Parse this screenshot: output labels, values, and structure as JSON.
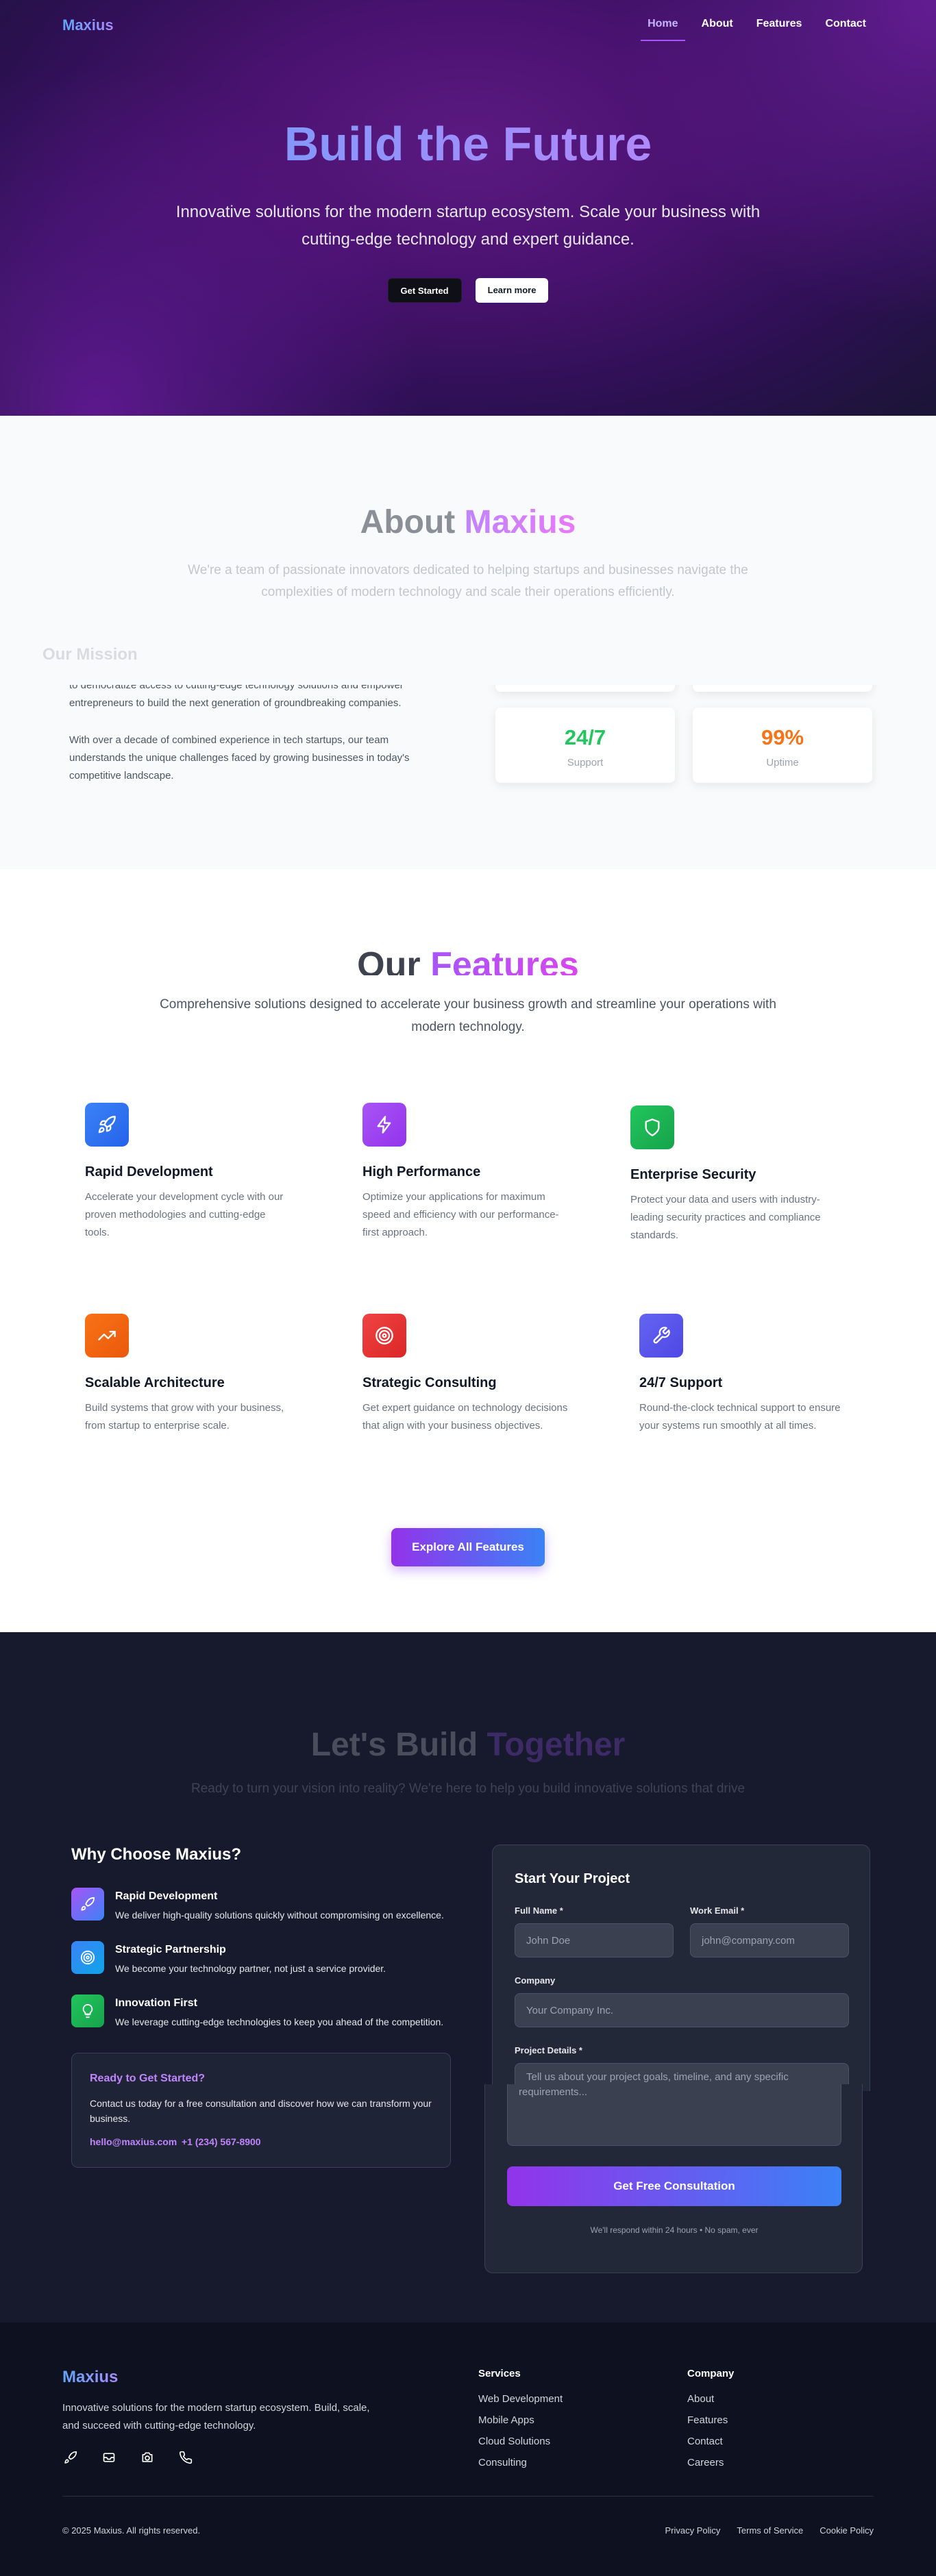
{
  "nav": {
    "logo": "Maxius",
    "links": [
      "Home",
      "About",
      "Features",
      "Contact"
    ]
  },
  "hero": {
    "title": "Build the Future",
    "subtitle": "Innovative solutions for the modern startup ecosystem. Scale your business with cutting-edge technology and expert guidance.",
    "primary_button": "Get Started",
    "secondary_button": "Learn more"
  },
  "about": {
    "title_plain": "About",
    "title_accent": "Maxius",
    "subtitle": "We're a team of passionate innovators dedicated to helping startups and businesses navigate the complexities of modern technology and scale their operations efficiently.",
    "mission_title": "Our Mission",
    "mission_p1": "to democratize access to cutting-edge technology solutions and empower entrepreneurs to build the next generation of groundbreaking companies.",
    "mission_p2": "With over a decade of combined experience in tech startups, our team understands the unique challenges faced by growing businesses in today's competitive landscape.",
    "stats": [
      {
        "value": "24/7",
        "label": "Support",
        "color": "#22c55e"
      },
      {
        "value": "99%",
        "label": "Uptime",
        "color": "#f97316"
      }
    ]
  },
  "features": {
    "title_plain": "Our",
    "title_accent": "Features",
    "subtitle": "Comprehensive solutions designed to accelerate your business growth and streamline your operations with modern technology.",
    "items": [
      {
        "name": "Rapid Development",
        "desc": "Accelerate your development cycle with our proven methodologies and cutting-edge tools.",
        "icon": "rocket-icon",
        "color": "#3b82f6"
      },
      {
        "name": "High Performance",
        "desc": "Optimize your applications for maximum speed and efficiency with our performance-first approach.",
        "icon": "lightning-icon",
        "color": "#a855f7"
      },
      {
        "name": "Enterprise Security",
        "desc": "Protect your data and users with industry-leading security practices and compliance standards.",
        "icon": "shield-icon",
        "color": "#16a34a"
      },
      {
        "name": "Scalable Architecture",
        "desc": "Build systems that grow with your business, from startup to enterprise scale.",
        "icon": "trending-up-icon",
        "color": "#f97316"
      },
      {
        "name": "Strategic Consulting",
        "desc": "Get expert guidance on technology decisions that align with your business objectives.",
        "icon": "target-icon",
        "color": "#ef4444"
      },
      {
        "name": "24/7 Support",
        "desc": "Round-the-clock technical support to ensure your systems run smoothly at all times.",
        "icon": "wrench-icon",
        "color": "#6366f1"
      }
    ],
    "explore_button": "Explore All Features"
  },
  "contact": {
    "title_plain": "Let's Build",
    "title_accent": "Together",
    "subtitle": "Ready to turn your vision into reality? We're here to help you build innovative solutions that drive",
    "why_title": "Why Choose Maxius?",
    "why_items": [
      {
        "name": "Rapid Development",
        "desc": "We deliver high-quality solutions quickly without compromising on excellence.",
        "icon": "rocket-icon"
      },
      {
        "name": "Strategic Partnership",
        "desc": "We become your technology partner, not just a service provider.",
        "icon": "target-icon"
      },
      {
        "name": "Innovation First",
        "desc": "We leverage cutting-edge technologies to keep you ahead of the competition.",
        "icon": "lightbulb-icon"
      }
    ],
    "ready_title": "Ready to Get Started?",
    "ready_text": "Contact us today for a free consultation and discover how we can transform your business.",
    "email": "hello@maxius.com",
    "phone": "+1 (234) 567-8900",
    "form": {
      "title": "Start Your Project",
      "full_name_label": "Full Name *",
      "full_name_placeholder": "John Doe",
      "email_label": "Work Email *",
      "email_placeholder": "john@company.com",
      "company_label": "Company",
      "company_placeholder": "Your Company Inc.",
      "details_label": "Project Details *",
      "details_placeholder_top": "Tell us about your project goals, timeline, and any specific",
      "details_placeholder_bottom": "requirements...",
      "submit": "Get Free Consultation",
      "note": "We'll respond within 24 hours • No spam, ever"
    }
  },
  "footer": {
    "logo": "Maxius",
    "description": "Innovative solutions for the modern startup ecosystem. Build, scale, and succeed with cutting-edge technology.",
    "services_title": "Services",
    "services": [
      "Web Development",
      "Mobile Apps",
      "Cloud Solutions",
      "Consulting"
    ],
    "company_title": "Company",
    "company": [
      "About",
      "Features",
      "Contact",
      "Careers"
    ],
    "copyright": "© 2025 Maxius. All rights reserved.",
    "legal": [
      "Privacy Policy",
      "Terms of Service",
      "Cookie Policy"
    ]
  }
}
